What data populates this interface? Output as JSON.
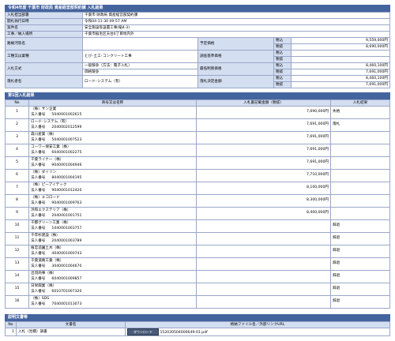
{
  "header": {
    "title": "令和4年度 千葉市 財政局 資産経営部契約課 入札結果"
  },
  "info": {
    "dept_label": "入札担当部署",
    "dept_value": "千葉市 財政局 資産経営部契約課",
    "date_label": "開札執行日時",
    "date_value": "令和04-11-30 09:57 AM",
    "case_label": "案件名",
    "case_value": "安全施設等設置工事(稲4-3)",
    "place_label": "工事／納入場所",
    "place_value": "千葉市稲毛区天台6丁目地内外",
    "route_label": "路線河等名",
    "route_value": "",
    "yotei_label": "予定価格",
    "yotei_tax_in_label": "税込",
    "yotei_tax_in": "9,559,000円",
    "yotei_tax_ex_label": "税抜",
    "yotei_tax_ex": "8,690,000円",
    "type_label": "工種又は業種",
    "type_value": "とび･土工･コンクリート工事",
    "survey_label": "調査基準価格",
    "survey_tax_in_label": "税込",
    "survey_tax_in": "",
    "survey_tax_ex_label": "税抜",
    "survey_tax_ex": "",
    "method_label": "入札方式",
    "method_value_1": "一般競争（方法：電子入札）",
    "method_value_2": "価格競争",
    "lowest_label": "最低制限価格",
    "lowest_tax_in_label": "税込",
    "lowest_tax_in": "8,460,100円",
    "lowest_tax_ex_label": "税抜",
    "lowest_tax_ex": "7,691,000円",
    "winner_label": "落札者名",
    "winner_value": "ロード･システム（有）",
    "decided_label": "落札決定金額",
    "decided_tax_in_label": "税込",
    "decided_tax_in": "8,460,100円",
    "decided_tax_ex_label": "税抜",
    "decided_tax_ex": "7,691,000円"
  },
  "bidding": {
    "title": "第1回入札結果",
    "col_no": "No",
    "col_name": "商号又は名称",
    "col_amount": "入札書記載金額（税抜）",
    "col_result": "入札結果",
    "corp_label": "法人番号",
    "rows": [
      {
        "no": "1",
        "name": "（株）サン企業",
        "corp": "5040001002615",
        "amount": "7,690,000円",
        "result": "失格"
      },
      {
        "no": "2",
        "name": "ロード･システム（有）",
        "corp": "2040002012599",
        "amount": "7,691,000円",
        "result": "落札"
      },
      {
        "no": "3",
        "name": "森川産業（株）",
        "corp": "5040001007523",
        "amount": "7,691,000円",
        "result": ""
      },
      {
        "no": "4",
        "name": "コーワー保安工業（株）",
        "corp": "6040001002275",
        "amount": "7,691,000円",
        "result": ""
      },
      {
        "no": "5",
        "name": "千葉ライナー（株）",
        "corp": "9040001004946",
        "amount": "7,691,000円",
        "result": ""
      },
      {
        "no": "6",
        "name": "（株）ダイリン",
        "corp": "8040001004195",
        "amount": "7,710,000円",
        "result": ""
      },
      {
        "no": "7",
        "name": "（株）ピーアイテック",
        "corp": "9040001012420",
        "amount": "8,100,000円",
        "result": ""
      },
      {
        "no": "8",
        "name": "（株）エコロード",
        "corp": "9040001009763",
        "amount": "8,300,000円",
        "result": ""
      },
      {
        "no": "9",
        "name": "浜和エクステリア（株）",
        "corp": "2040001001751",
        "amount": "8,400,000円",
        "result": ""
      },
      {
        "no": "10",
        "name": "千都グリーン工業（株）",
        "corp": "1040001003757",
        "amount": "",
        "result": "辞退"
      },
      {
        "no": "11",
        "name": "千年杉建設（株）",
        "corp": "2040001003789",
        "amount": "",
        "result": "辞退"
      },
      {
        "no": "12",
        "name": "植忠造園土木（株）",
        "corp": "4040001000743",
        "amount": "",
        "result": "辞退"
      },
      {
        "no": "13",
        "name": "千葉道路工業（株）",
        "corp": "3040001004670",
        "amount": "",
        "result": "辞退"
      },
      {
        "no": "14",
        "name": "出羽商事（株）",
        "corp": "6040001009857",
        "amount": "",
        "result": "辞退"
      },
      {
        "no": "15",
        "name": "日栄興業（株）",
        "corp": "6010701007320",
        "amount": "",
        "result": "辞退"
      },
      {
        "no": "16",
        "name": "（株）SDS",
        "corp": "7040001013073",
        "amount": "",
        "result": "辞退"
      }
    ]
  },
  "docs": {
    "title": "説明文書等",
    "col_no": "No",
    "col_name": "文書名",
    "col_file": "格納ファイル名／外部リンクURL",
    "rows": [
      {
        "no": "1",
        "name": "入札（見積）調書",
        "download": "ダウンロード",
        "file": "152030504000649-01.pdf"
      }
    ]
  }
}
